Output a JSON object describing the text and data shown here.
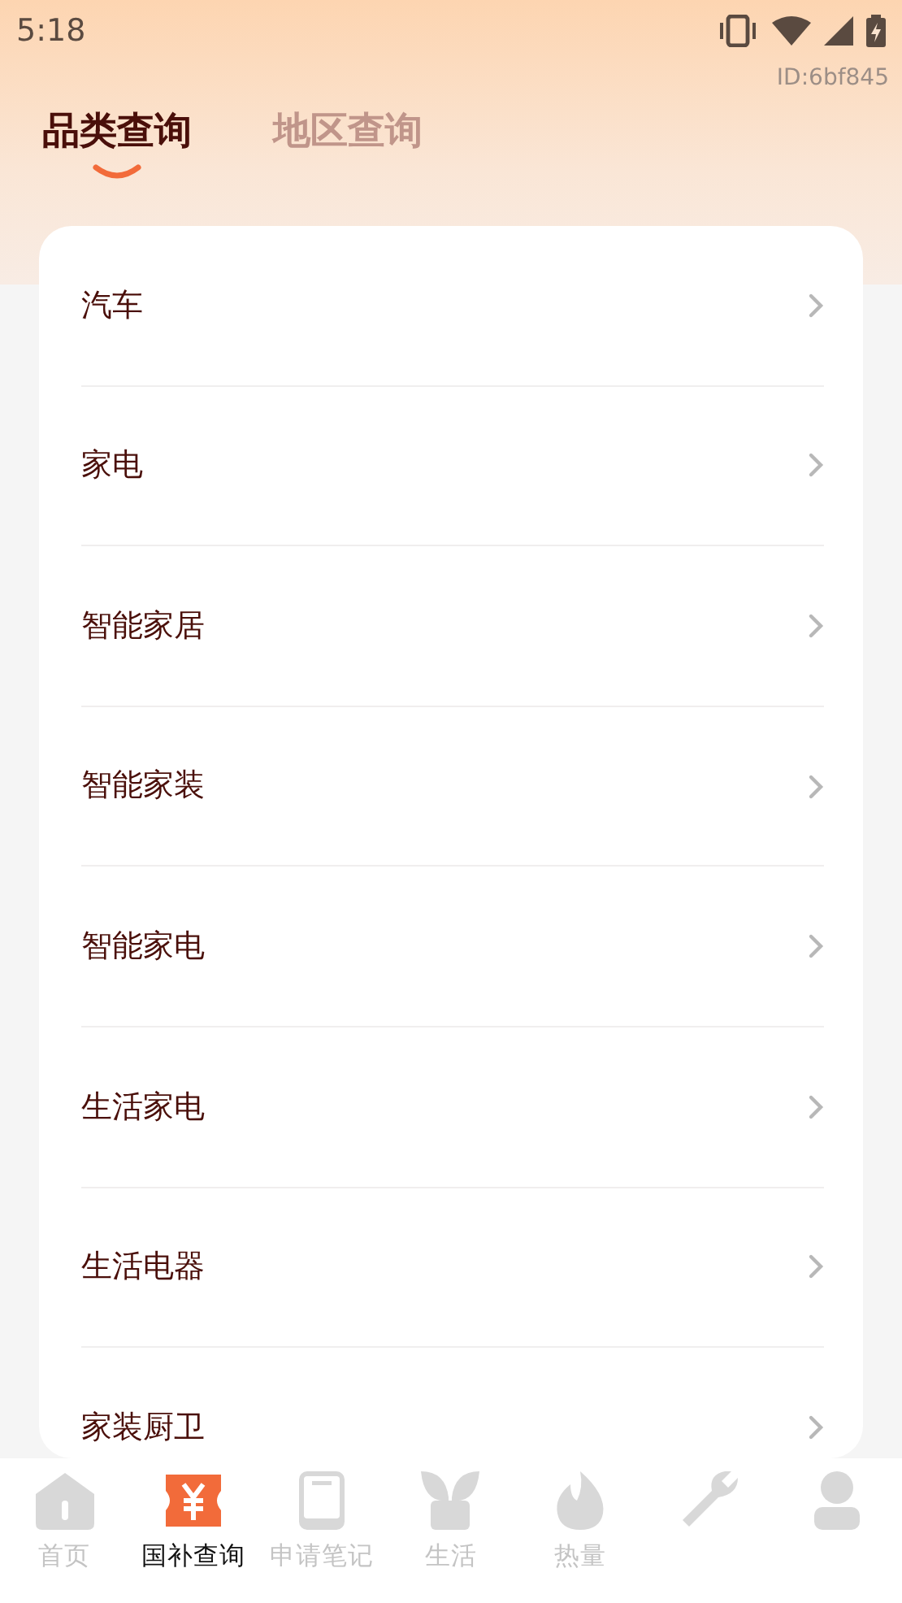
{
  "status_bar": {
    "time": "5:18"
  },
  "id_label": "ID:6bf845",
  "tabs": [
    {
      "label": "品类查询",
      "selected": true
    },
    {
      "label": "地区查询",
      "selected": false
    }
  ],
  "categories": [
    {
      "label": "汽车"
    },
    {
      "label": "家电"
    },
    {
      "label": "智能家居"
    },
    {
      "label": "智能家装"
    },
    {
      "label": "智能家电"
    },
    {
      "label": "生活家电"
    },
    {
      "label": "生活电器"
    },
    {
      "label": "家装厨卫"
    }
  ],
  "bottom_nav": [
    {
      "kind": "home",
      "label": "首页",
      "selected": false
    },
    {
      "kind": "ticket",
      "label": "国补查询",
      "selected": true
    },
    {
      "kind": "notebook",
      "label": "申请笔记",
      "selected": false
    },
    {
      "kind": "plant",
      "label": "生活",
      "selected": false
    },
    {
      "kind": "flame",
      "label": "热量",
      "selected": false
    },
    {
      "kind": "wrench",
      "selected": false
    },
    {
      "kind": "person",
      "selected": false
    }
  ]
}
